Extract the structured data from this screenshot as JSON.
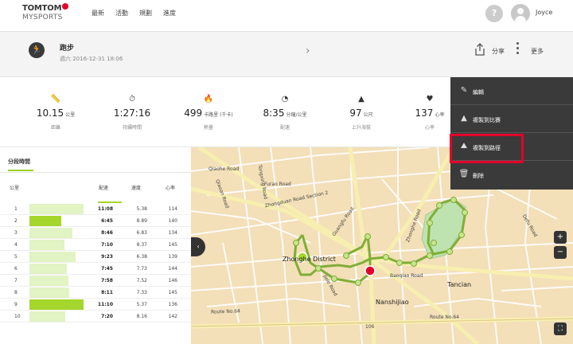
{
  "header": {
    "logo_top": "TOMTOM",
    "logo_bottom": "MYSPORTS",
    "nav": [
      "最新",
      "活動",
      "規劃",
      "進度"
    ],
    "help": "?",
    "username": "Joyce"
  },
  "activity": {
    "title": "跑步",
    "date": "週六 2016-12-31 18:06",
    "share_label": "分享",
    "more_label": "更多"
  },
  "stats": [
    {
      "icon": "ruler-icon",
      "value": "10.15",
      "unit": "公里",
      "label": "距離"
    },
    {
      "icon": "stopwatch-icon",
      "value": "1:27:16",
      "unit": "",
      "label": "持續時間"
    },
    {
      "icon": "flame-icon",
      "value": "499",
      "unit": "卡路里 (千卡)",
      "label": "熱量"
    },
    {
      "icon": "speedometer-icon",
      "value": "8:35",
      "unit": "分鐘/公里",
      "label": "配速"
    },
    {
      "icon": "mountain-icon",
      "value": "97",
      "unit": "公尺",
      "label": "上升海拔"
    },
    {
      "icon": "heart-icon",
      "value": "137",
      "unit": "心率",
      "label": "心率"
    }
  ],
  "splits": {
    "tab_label": "分段時間",
    "columns": {
      "km": "公里",
      "pace": "配速",
      "speed": "速度",
      "hr": "心率"
    },
    "rows": [
      {
        "km": "1",
        "pace": "11:08",
        "speed": "5.38",
        "hr": "114",
        "fill": 0.85,
        "highlight": false
      },
      {
        "km": "2",
        "pace": "6:45",
        "speed": "8.89",
        "hr": "140",
        "fill": 0.5,
        "highlight": true
      },
      {
        "km": "3",
        "pace": "8:46",
        "speed": "6.83",
        "hr": "134",
        "fill": 0.67,
        "highlight": false
      },
      {
        "km": "4",
        "pace": "7:10",
        "speed": "8.37",
        "hr": "145",
        "fill": 0.55,
        "highlight": false
      },
      {
        "km": "5",
        "pace": "9:23",
        "speed": "6.38",
        "hr": "139",
        "fill": 0.72,
        "highlight": false
      },
      {
        "km": "6",
        "pace": "7:45",
        "speed": "7.73",
        "hr": "144",
        "fill": 0.59,
        "highlight": false
      },
      {
        "km": "7",
        "pace": "7:58",
        "speed": "7.52",
        "hr": "146",
        "fill": 0.61,
        "highlight": false
      },
      {
        "km": "8",
        "pace": "8:11",
        "speed": "7.33",
        "hr": "145",
        "fill": 0.63,
        "highlight": false
      },
      {
        "km": "9",
        "pace": "11:10",
        "speed": "5.37",
        "hr": "136",
        "fill": 0.85,
        "highlight": true
      },
      {
        "km": "10",
        "pace": "7:20",
        "speed": "8.16",
        "hr": "142",
        "fill": 0.56,
        "highlight": false
      }
    ]
  },
  "map": {
    "labels": [
      {
        "text": "Qiaohe Road",
        "cls": ""
      },
      {
        "text": "Furao Road",
        "cls": ""
      },
      {
        "text": "Qiaoan Road",
        "cls": ""
      },
      {
        "text": "Tongxing Road",
        "cls": ""
      },
      {
        "text": "Zhongduan Road Section 2",
        "cls": ""
      },
      {
        "text": "Guangfu Road",
        "cls": ""
      },
      {
        "text": "Zhonghe Road",
        "cls": ""
      },
      {
        "text": "Zhonghe District",
        "cls": "big"
      },
      {
        "text": "Tancian",
        "cls": "big"
      },
      {
        "text": "Nanshijiao",
        "cls": "big"
      },
      {
        "text": "Route No.64",
        "cls": ""
      },
      {
        "text": "Route No.64",
        "cls": ""
      },
      {
        "text": "106",
        "cls": ""
      },
      {
        "text": "Defu Road",
        "cls": ""
      },
      {
        "text": "Baoqiao Road",
        "cls": ""
      },
      {
        "text": "Jiele Road",
        "cls": ""
      }
    ],
    "zoom_in": "+",
    "zoom_out": "−",
    "collapse": "‹",
    "fullscreen": "⛶"
  },
  "dropdown": {
    "items": [
      {
        "icon": "pencil-icon",
        "label": "編輯"
      },
      {
        "icon": "mountains-icon",
        "label": "複製到比賽"
      },
      {
        "icon": "route-icon",
        "label": "複製到路徑"
      },
      {
        "icon": "trash-icon",
        "label": "刪除"
      }
    ]
  }
}
